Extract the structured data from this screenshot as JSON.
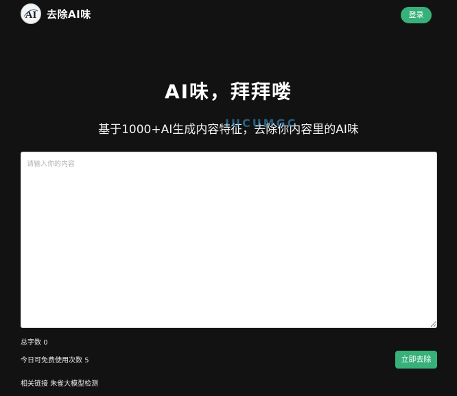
{
  "header": {
    "logo_text": "AI",
    "brand": "去除AI味",
    "login_label": "登录"
  },
  "hero": {
    "title": "AI味，拜拜喽",
    "subtitle": "基于1000+AI生成内容特征，去除你内容里的AI味",
    "watermark": "IUCUMGC"
  },
  "editor": {
    "placeholder": "请输入你的内容",
    "value": ""
  },
  "stats": {
    "total_label": "总字数",
    "total_count": "0",
    "free_label": "今日可免费使用次数",
    "free_count": "5"
  },
  "actions": {
    "remove_label": "立即去除"
  },
  "related": {
    "label": "相关链接",
    "link_text": "朱雀大模型检测"
  },
  "colors": {
    "background": "#121212",
    "accent": "#37b07a",
    "text": "#e8e8e8"
  }
}
